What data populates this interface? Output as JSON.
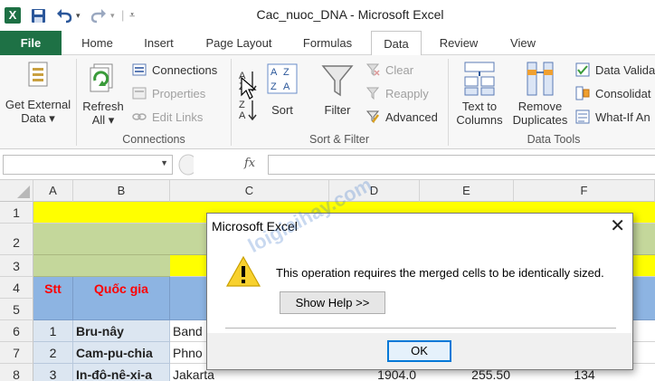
{
  "window": {
    "title": "Cac_nuoc_DNA - Microsoft Excel",
    "app_icon": "X"
  },
  "tabs": [
    {
      "label": "File"
    },
    {
      "label": "Home"
    },
    {
      "label": "Insert"
    },
    {
      "label": "Page Layout"
    },
    {
      "label": "Formulas"
    },
    {
      "label": "Data"
    },
    {
      "label": "Review"
    },
    {
      "label": "View"
    }
  ],
  "ribbon": {
    "get_external_data": {
      "line1": "Get External",
      "line2": "Data ▾"
    },
    "refresh_all": {
      "line1": "Refresh",
      "line2": "All ▾"
    },
    "connections": "Connections",
    "properties": "Properties",
    "edit_links": "Edit Links",
    "sort": "Sort",
    "filter": "Filter",
    "clear": "Clear",
    "reapply": "Reapply",
    "advanced": "Advanced",
    "text_to_columns": {
      "line1": "Text to",
      "line2": "Columns"
    },
    "remove_duplicates": {
      "line1": "Remove",
      "line2": "Duplicates"
    },
    "data_validation": "Data Valida",
    "consolidate": "Consolidat",
    "what_if": "What-If An",
    "groups": {
      "connections": "Connections",
      "sort_filter": "Sort & Filter",
      "data_tools": "Data Tools"
    }
  },
  "formula_bar": {
    "fx": "fx",
    "value": ""
  },
  "grid": {
    "columns": [
      "A",
      "B",
      "C",
      "D",
      "E",
      "F"
    ],
    "rows": [
      "1",
      "2",
      "3",
      "4",
      "5",
      "6",
      "7",
      "8"
    ],
    "headers": {
      "stt": "Stt",
      "quoc_gia": "Quốc gia"
    },
    "data_rows": [
      {
        "stt": "1",
        "country": "Bru-nây",
        "capital": "Band"
      },
      {
        "stt": "2",
        "country": "Cam-pu-chia",
        "capital": "Phno"
      },
      {
        "stt": "3",
        "country": "In-đô-nê-xi-a",
        "capital": "Jakarta",
        "d": "1904.0",
        "e": "255.50",
        "f": "134"
      }
    ]
  },
  "dialog": {
    "title": "Microsoft Excel",
    "message": "This operation requires the merged cells to be identically sized.",
    "help_button": "Show Help >>",
    "ok_button": "OK"
  },
  "watermark": "loigiaihay.com",
  "colors": {
    "excel_green": "#1e7145",
    "header_yellow": "#ffff00",
    "band_green": "#c4d79b",
    "header_blue": "#8db4e2",
    "accent_red": "#ff0000"
  }
}
